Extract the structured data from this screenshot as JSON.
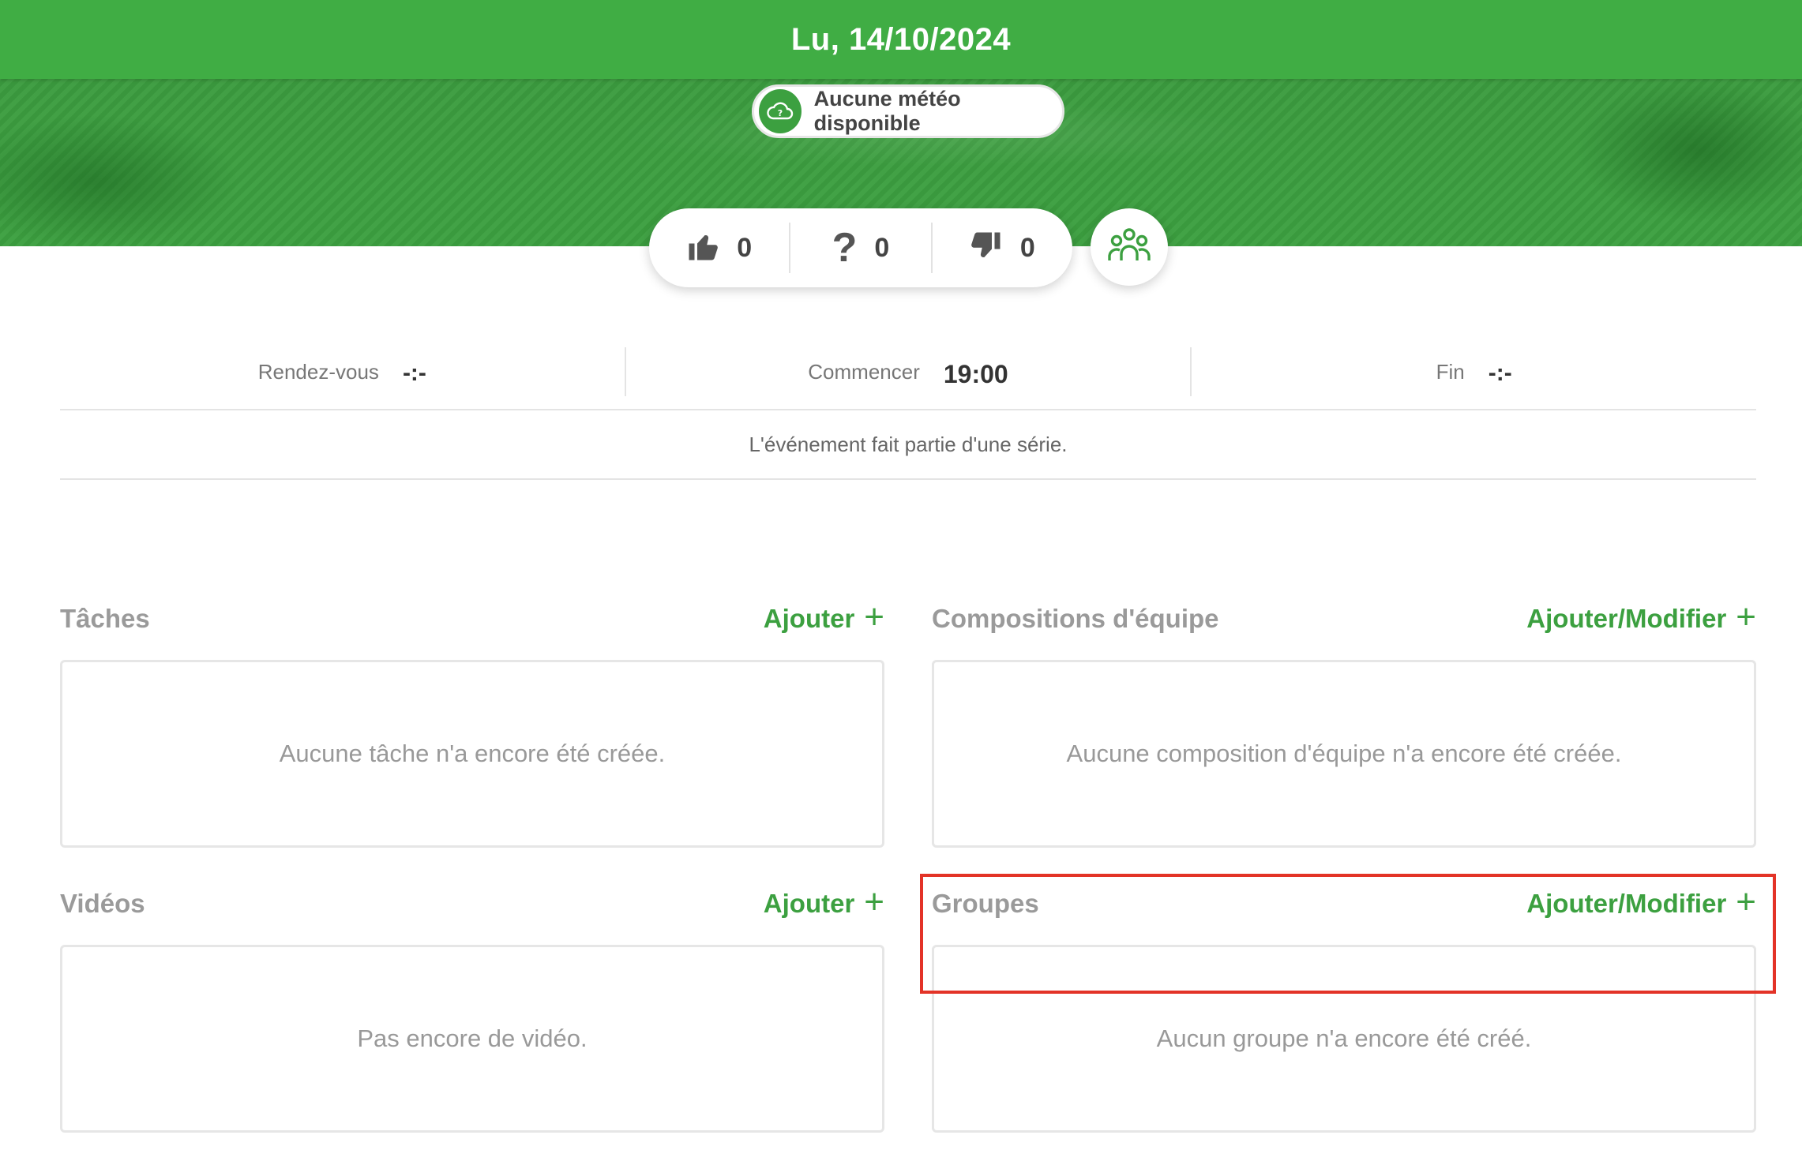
{
  "header": {
    "date": "Lu, 14/10/2024",
    "weather_text": "Aucune météo disponible"
  },
  "votes": {
    "yes_count": "0",
    "maybe_symbol": "?",
    "maybe_count": "0",
    "no_count": "0"
  },
  "times": {
    "meeting_label": "Rendez-vous",
    "meeting_value": "-:-",
    "start_label": "Commencer",
    "start_value": "19:00",
    "end_label": "Fin",
    "end_value": "-:-"
  },
  "series_note": "L'événement fait partie d'une série.",
  "sections": {
    "tasks": {
      "title": "Tâches",
      "action": "Ajouter",
      "empty": "Aucune tâche n'a encore été créée."
    },
    "lineups": {
      "title": "Compositions d'équipe",
      "action": "Ajouter/Modifier",
      "empty": "Aucune composition d'équipe n'a encore été créée."
    },
    "videos": {
      "title": "Vidéos",
      "action": "Ajouter",
      "empty": "Pas encore de vidéo."
    },
    "groups": {
      "title": "Groupes",
      "action": "Ajouter/Modifier",
      "empty": "Aucun groupe n'a encore été créé."
    }
  },
  "plus_symbol": "+",
  "colors": {
    "brand_green": "#40ad44",
    "highlight_red": "#e33327"
  }
}
